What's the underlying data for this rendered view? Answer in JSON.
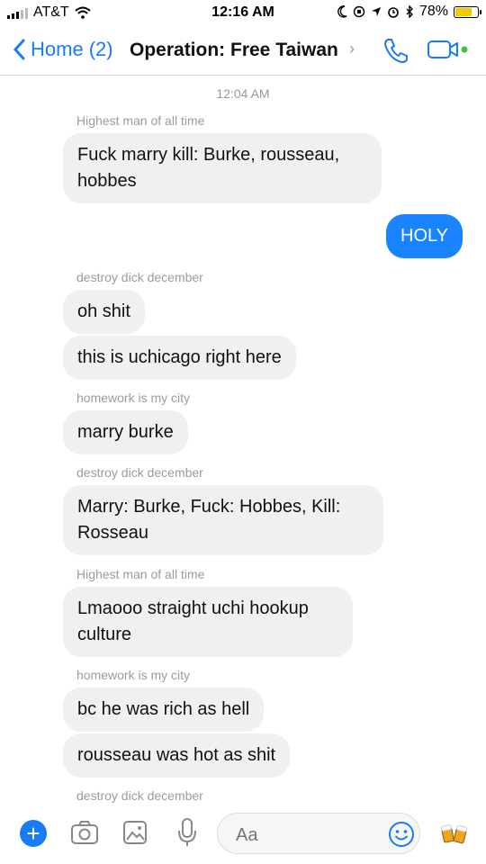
{
  "status": {
    "carrier": "AT&T",
    "time": "12:16 AM",
    "battery_percent": "78%",
    "battery_level": 0.78,
    "signal_bars": 2
  },
  "nav": {
    "back_label": "Home",
    "unread": "(2)",
    "title": "Operation: Free Taiwan"
  },
  "thread": {
    "timestamp": "12:04 AM",
    "items": [
      {
        "kind": "sender",
        "text": "Highest man of all time"
      },
      {
        "kind": "in",
        "text": "Fuck marry kill: Burke, rousseau, hobbes"
      },
      {
        "kind": "out",
        "text": "HOLY"
      },
      {
        "kind": "sender",
        "text": "destroy dick december"
      },
      {
        "kind": "in",
        "text": "oh shit"
      },
      {
        "kind": "in",
        "text": "this is uchicago right here"
      },
      {
        "kind": "sender",
        "text": "homework is my city"
      },
      {
        "kind": "in",
        "text": "marry burke"
      },
      {
        "kind": "sender",
        "text": "destroy dick december"
      },
      {
        "kind": "in",
        "text": "Marry: Burke, Fuck: Hobbes, Kill: Rosseau"
      },
      {
        "kind": "sender",
        "text": "Highest man of all time"
      },
      {
        "kind": "in",
        "text": "Lmaooo straight uchi hookup culture"
      },
      {
        "kind": "sender",
        "text": "homework is my city"
      },
      {
        "kind": "in",
        "text": "bc he was rich as hell"
      },
      {
        "kind": "in",
        "text": "rousseau was hot as shit"
      },
      {
        "kind": "sender",
        "text": "destroy dick december"
      }
    ]
  },
  "composer": {
    "placeholder": "Aa"
  },
  "colors": {
    "accent": "#1a7cf5",
    "outgoing_bubble": "#1a84ff",
    "incoming_bubble": "#f0f0f0",
    "battery_fill": "#f5c800"
  },
  "icons": [
    "wifi-icon",
    "alarm-icon",
    "location-icon",
    "bluetooth-icon",
    "back-chevron-icon",
    "chevron-right-icon",
    "phone-icon",
    "video-camera-icon",
    "plus-icon",
    "camera-icon",
    "image-icon",
    "microphone-icon",
    "emoji-icon",
    "beer-mugs-icon"
  ]
}
